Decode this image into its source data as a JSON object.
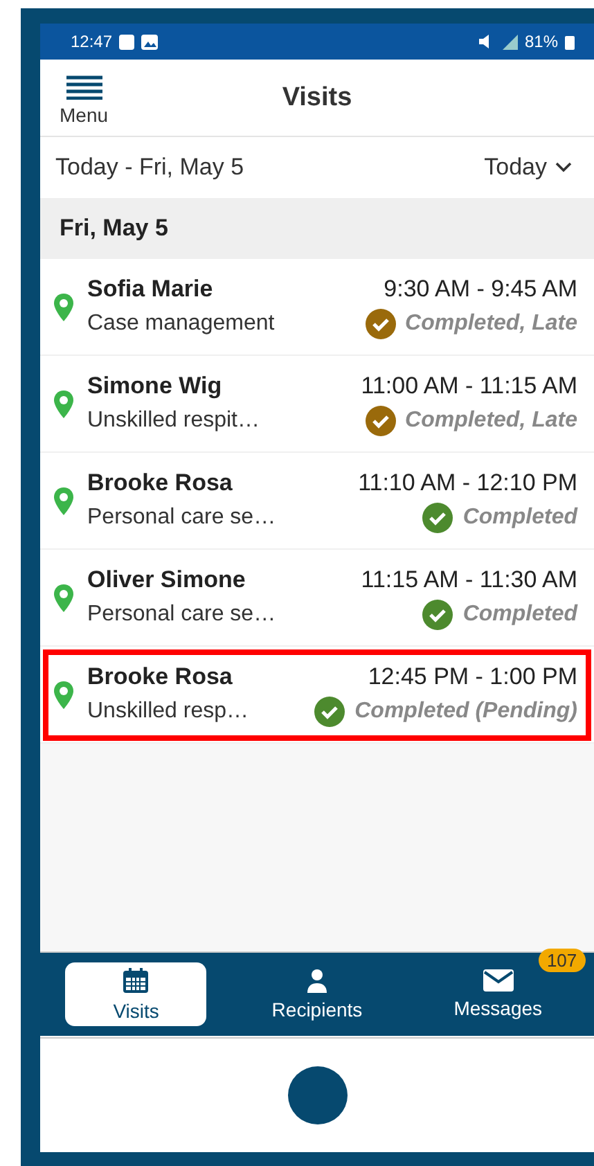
{
  "status_bar": {
    "time": "12:47",
    "battery": "81%"
  },
  "header": {
    "menu_label": "Menu",
    "title": "Visits"
  },
  "date_bar": {
    "range": "Today - Fri, May 5",
    "filter": "Today"
  },
  "section": {
    "title": "Fri, May 5"
  },
  "visits": [
    {
      "name": "Sofia Marie",
      "service": "Case management",
      "time": "9:30 AM - 9:45 AM",
      "status": "Completed, Late",
      "color": "#9a6a0b",
      "highlighted": false
    },
    {
      "name": "Simone Wig",
      "service": "Unskilled respit…",
      "time": "11:00 AM - 11:15 AM",
      "status": "Completed, Late",
      "color": "#9a6a0b",
      "highlighted": false
    },
    {
      "name": "Brooke Rosa",
      "service": "Personal care se…",
      "time": "11:10 AM - 12:10 PM",
      "status": "Completed",
      "color": "#4d8a2e",
      "highlighted": false
    },
    {
      "name": "Oliver Simone",
      "service": "Personal care se…",
      "time": "11:15 AM - 11:30 AM",
      "status": "Completed",
      "color": "#4d8a2e",
      "highlighted": false
    },
    {
      "name": "Brooke Rosa",
      "service": "Unskilled resp…",
      "time": "12:45 PM - 1:00 PM",
      "status": "Completed (Pending)",
      "color": "#4d8a2e",
      "highlighted": true
    }
  ],
  "tabs": [
    {
      "label": "Visits",
      "kind": "calendar",
      "selected": true
    },
    {
      "label": "Recipients",
      "kind": "person",
      "selected": false
    },
    {
      "label": "Messages",
      "kind": "mail",
      "selected": false,
      "badge": "107"
    }
  ]
}
